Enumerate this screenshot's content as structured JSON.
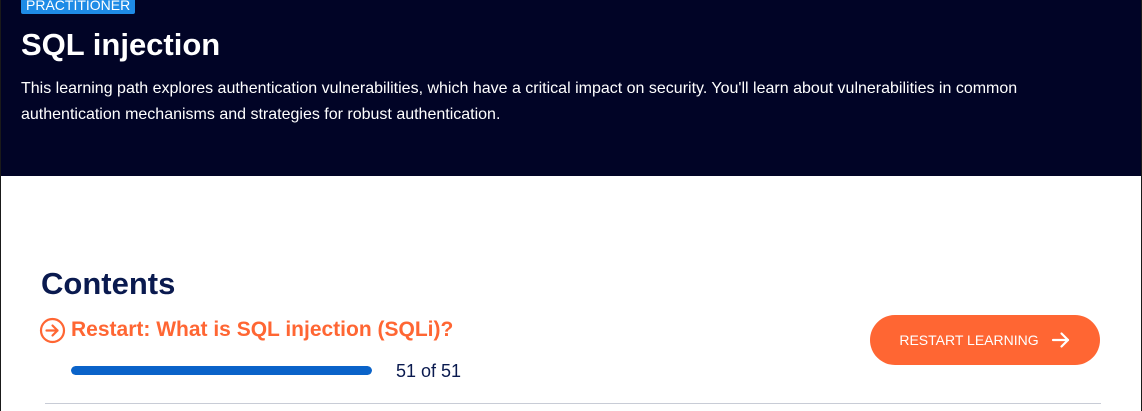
{
  "hero": {
    "level_badge": "PRACTITIONER",
    "title": "SQL injection",
    "description": "This learning path explores authentication vulnerabilities, which have a critical impact on security. You'll learn about vulnerabilities in common authentication mechanisms and strategies for robust authentication."
  },
  "contents": {
    "heading": "Contents",
    "module": {
      "icon": "arrow-circle-right-icon",
      "title": "Restart: What is SQL injection (SQLi)?",
      "progress_completed": 51,
      "progress_total": 51,
      "progress_text": "51 of 51",
      "restart_label": "RESTART LEARNING",
      "restart_icon": "arrow-right-icon"
    }
  },
  "colors": {
    "hero_bg": "#010426",
    "badge_bg": "#1e8be6",
    "accent": "#ff6633",
    "heading": "#0a1a4f",
    "progress_fill": "#0a63c9"
  }
}
